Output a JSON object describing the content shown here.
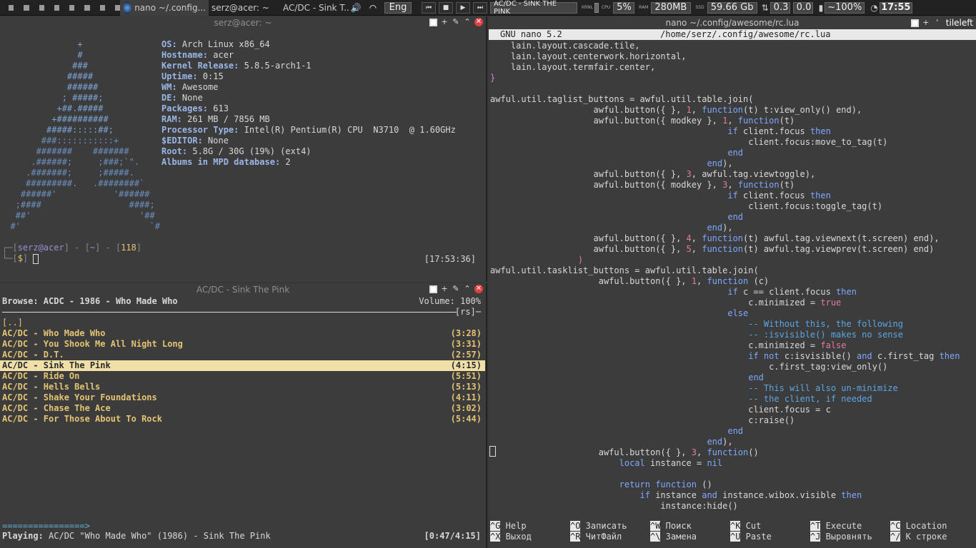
{
  "panel": {
    "tasks": [
      {
        "label": "nano ~/.config...",
        "icon": "terminal-icon",
        "active": true
      },
      {
        "label": "serz@acer: ~",
        "active": false
      },
      {
        "label": "AC/DC - Sink T...",
        "active": false
      }
    ],
    "volume_icon": "speaker-icon",
    "wifi_icon": "wifi-icon",
    "layout": "Eng",
    "mpd_track": "AC/DC - SINK THE PINK",
    "kernel_label": "KRNL",
    "cpu_label": "CPU",
    "cpu": "5%",
    "ram_label": "RAM",
    "ram": "280MB",
    "ssd_label": "SSD",
    "disk": "59.66 Gb",
    "net_down": "0.3",
    "net_up": "0.0",
    "battery": "~100%",
    "time": "17:55"
  },
  "term": {
    "title": "serz@acer: ~",
    "art": [
      "               +",
      "               #",
      "              ###",
      "             #####",
      "             ######",
      "            ; #####;",
      "           +##.#####",
      "          +##########",
      "         #####:::::##;",
      "        ###:::::::::::+",
      "       #######    #######",
      "      .######;     ;###;`\".",
      "     .#######;     ;#####.",
      "     #########.   .########`",
      "    ######'           '######",
      "   ;####                 ####;",
      "   ##'                     '##",
      "  #'                         `#"
    ],
    "info": [
      {
        "k": "OS:",
        "v": " Arch Linux x86_64"
      },
      {
        "k": "Hostname:",
        "v": " acer"
      },
      {
        "k": "Kernel Release:",
        "v": " 5.8.5-arch1-1"
      },
      {
        "k": "Uptime:",
        "v": " 0:15"
      },
      {
        "k": "WM:",
        "v": " Awesome"
      },
      {
        "k": "DE:",
        "v": " None"
      },
      {
        "k": "Packages:",
        "v": " 613"
      },
      {
        "k": "RAM:",
        "v": " 261 MB / 7856 MB"
      },
      {
        "k": "Processor Type:",
        "v": " Intel(R) Pentium(R) CPU  N3710  @ 1.60GHz"
      },
      {
        "k": "$EDITOR:",
        "v": " None"
      },
      {
        "k": "Root:",
        "v": " 5.8G / 30G (19%) (ext4)"
      },
      {
        "k": "Albums in MPD database:",
        "v": " 2"
      }
    ],
    "prompt_user": "serz@acer",
    "prompt_dir": "~",
    "prompt_num": "118",
    "prompt_sym": "$",
    "prompt_time": "[17:53:36]"
  },
  "ncmpcpp": {
    "title": "AC/DC - Sink The Pink",
    "browse": "Browse: ACDC - 1986 - Who Made Who",
    "volume": "Volume: 100%",
    "flags": "[rs]",
    "parent": "[..]",
    "tracks": [
      {
        "name": "AC/DC - Who Made Who",
        "time": "(3:28)"
      },
      {
        "name": "AC/DC - You Shook Me All Night Long",
        "time": "(3:31)"
      },
      {
        "name": "AC/DC - D.T.",
        "time": "(2:57)"
      },
      {
        "name": "AC/DC - Sink The Pink",
        "time": "(4:15)"
      },
      {
        "name": "AC/DC - Ride On",
        "time": "(5:51)"
      },
      {
        "name": "AC/DC - Hells Bells",
        "time": "(5:13)"
      },
      {
        "name": "AC/DC - Shake Your Foundations",
        "time": "(4:11)"
      },
      {
        "name": "AC/DC - Chase The Ace",
        "time": "(3:02)"
      },
      {
        "name": "AC/DC - For Those About To Rock",
        "time": "(5:44)"
      }
    ],
    "selected": 3,
    "progress_bar": "================>",
    "playing_label": "Playing:",
    "playing": " AC/DC \"Who Made Who\" (1986) - Sink The Pink",
    "position": "[0:47/4:15]"
  },
  "nano": {
    "title": "nano ~/.config/awesome/rc.lua",
    "layout_name": "tileleft",
    "version": "GNU nano 5.2",
    "file": "/home/serz/.config/awesome/rc.lua",
    "shortcuts": [
      {
        "key": "^G",
        "label": "Help"
      },
      {
        "key": "^O",
        "label": "Записать"
      },
      {
        "key": "^W",
        "label": "Поиск"
      },
      {
        "key": "^K",
        "label": "Cut"
      },
      {
        "key": "^T",
        "label": "Execute"
      },
      {
        "key": "^C",
        "label": "Location"
      },
      {
        "key": "^X",
        "label": "Выход"
      },
      {
        "key": "^R",
        "label": "ЧитФайл"
      },
      {
        "key": "^\\",
        "label": "Замена"
      },
      {
        "key": "^U",
        "label": "Paste"
      },
      {
        "key": "^J",
        "label": "Выровнять"
      },
      {
        "key": "^/",
        "label": "К строке"
      }
    ]
  }
}
